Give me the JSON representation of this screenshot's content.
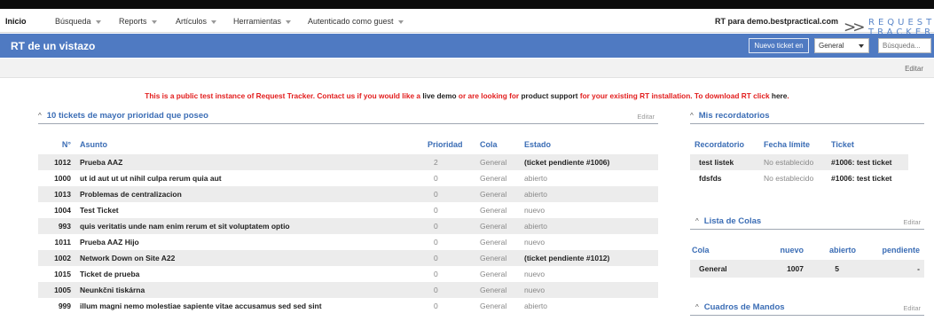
{
  "menu": {
    "home": "Inicio",
    "items": [
      "Búsqueda",
      "Reports",
      "Artículos",
      "Herramientas",
      "Autenticado como guest"
    ],
    "rt_for": "RT para demo.bestpractical.com",
    "logo_text_1": "REQUEST",
    "logo_text_2": "TRACKER"
  },
  "titlebar": {
    "title": "RT de un vistazo",
    "new_ticket_label": "Nuevo ticket en",
    "queue_value": "General",
    "search_placeholder": "Búsqueda..."
  },
  "editbar": {
    "edit_label": "Editar"
  },
  "notice": {
    "part1": "This is a public test instance of Request Tracker. Contact us if you would like a ",
    "link1": "live demo",
    "part2": " or are looking for ",
    "link2": "product support",
    "part3": " for your existing RT installation. To download RT click ",
    "link3": "here",
    "part4": "."
  },
  "tickets_panel": {
    "title": "10 tickets de mayor prioridad que poseo",
    "edit_label": "Editar",
    "headers": {
      "num": "N°",
      "subject": "Asunto",
      "priority": "Prioridad",
      "queue": "Cola",
      "status": "Estado"
    },
    "rows": [
      {
        "id": "1012",
        "subject": "Prueba AAZ",
        "priority": "2",
        "queue": "General",
        "status": "(ticket pendiente #1006)",
        "status_bold": true
      },
      {
        "id": "1000",
        "subject": "ut id aut ut ut nihil culpa rerum quia aut",
        "priority": "0",
        "queue": "General",
        "status": "abierto",
        "status_bold": false
      },
      {
        "id": "1013",
        "subject": "Problemas de centralizacion",
        "priority": "0",
        "queue": "General",
        "status": "abierto",
        "status_bold": false
      },
      {
        "id": "1004",
        "subject": "Test Ticket",
        "priority": "0",
        "queue": "General",
        "status": "nuevo",
        "status_bold": false
      },
      {
        "id": "993",
        "subject": "quis veritatis unde nam enim rerum et sit voluptatem optio",
        "priority": "0",
        "queue": "General",
        "status": "abierto",
        "status_bold": false
      },
      {
        "id": "1011",
        "subject": "Prueba AAZ Hijo",
        "priority": "0",
        "queue": "General",
        "status": "nuevo",
        "status_bold": false
      },
      {
        "id": "1002",
        "subject": "Network Down on Site A22",
        "priority": "0",
        "queue": "General",
        "status": "(ticket pendiente #1012)",
        "status_bold": true
      },
      {
        "id": "1015",
        "subject": "Ticket de prueba",
        "priority": "0",
        "queue": "General",
        "status": "nuevo",
        "status_bold": false
      },
      {
        "id": "1005",
        "subject": "Neunkčni tiskárna",
        "priority": "0",
        "queue": "General",
        "status": "nuevo",
        "status_bold": false
      },
      {
        "id": "999",
        "subject": "illum magni nemo molestiae sapiente vitae accusamus sed sed sint",
        "priority": "0",
        "queue": "General",
        "status": "abierto",
        "status_bold": false
      }
    ]
  },
  "reminders_panel": {
    "title": "Mis recordatorios",
    "headers": {
      "reminder": "Recordatorio",
      "due": "Fecha límite",
      "ticket": "Ticket"
    },
    "rows": [
      {
        "reminder": "test listek",
        "due": "No establecido",
        "ticket": "#1006: test ticket"
      },
      {
        "reminder": "fdsfds",
        "due": "No establecido",
        "ticket": "#1006: test ticket"
      }
    ]
  },
  "queues_panel": {
    "title": "Lista de Colas",
    "edit_label": "Editar",
    "headers": {
      "queue": "Cola",
      "new": "nuevo",
      "open": "abierto",
      "pending": "pendiente"
    },
    "rows": [
      {
        "queue": "General",
        "new": "1007",
        "open": "5",
        "pending": "-"
      }
    ]
  },
  "dashboards_panel": {
    "title": "Cuadros de Mandos",
    "edit_label": "Editar"
  }
}
